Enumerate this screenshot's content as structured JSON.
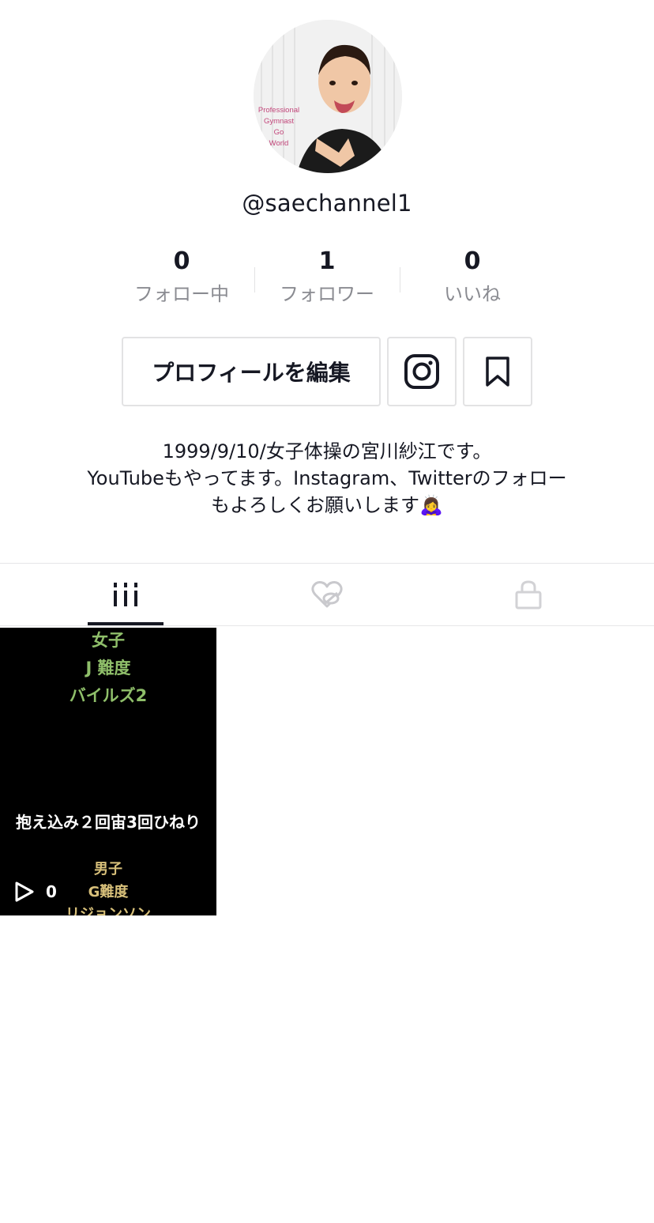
{
  "profile": {
    "handle": "@saechannel1",
    "avatar_overlay_text": [
      "Professional",
      "Gymnast",
      "Go",
      "World"
    ]
  },
  "stats": [
    {
      "value": "0",
      "label": "フォロー中"
    },
    {
      "value": "1",
      "label": "フォロワー"
    },
    {
      "value": "0",
      "label": "いいね"
    }
  ],
  "actions": {
    "edit_profile_label": "プロフィールを編集",
    "instagram_icon": "instagram-icon",
    "bookmark_icon": "bookmark-icon"
  },
  "bio": {
    "lines": [
      "1999/9/10/女子体操の宮川紗江です。",
      "YouTubeもやってます。Instagram、Twitterのフォロー",
      "もよろしくお願いします🙇‍♀️"
    ]
  },
  "tabs": [
    {
      "icon": "grid-icon",
      "active": true
    },
    {
      "icon": "liked-hidden-icon",
      "active": false
    },
    {
      "icon": "lock-icon",
      "active": false
    }
  ],
  "videos": [
    {
      "text_lines": [
        "女子",
        "J 難度",
        "バイルズ2",
        "抱え込み２回宙3回ひねり",
        "男子",
        "G難度",
        "リジョンソン"
      ],
      "play_count": "0"
    }
  ],
  "colors": {
    "primary_text": "#161823",
    "secondary_text": "#8a8b91",
    "border": "#e3e3e4",
    "thumb_green": "#8fbf6a",
    "thumb_yellow": "#d8c07a"
  }
}
